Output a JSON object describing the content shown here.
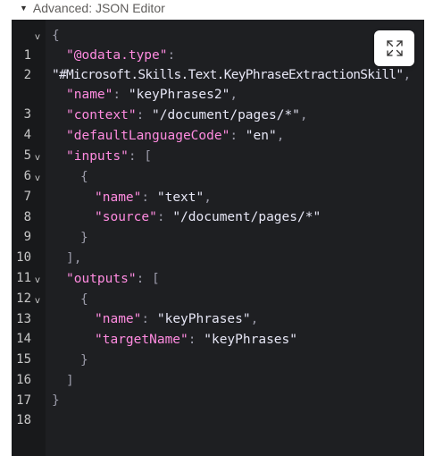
{
  "section": {
    "caret_icon": "caret-down-icon",
    "title": "Advanced: JSON Editor"
  },
  "editor": {
    "expand_icon": "expand-icon",
    "fold_glyph": "v",
    "lines": [
      {
        "n": "1",
        "text": "{"
      },
      {
        "n": "2",
        "key": "\"@odata.type\"",
        "sep": ":"
      },
      {
        "n": "",
        "value": "\"#Microsoft.Skills.Text.KeyPhraseExtractionSkill\"",
        "sep": ","
      },
      {
        "n": "3",
        "key": "\"name\"",
        "sep": ": ",
        "value": "\"keyPhrases2\"",
        "end": ","
      },
      {
        "n": "4",
        "key": "\"context\"",
        "sep": ": ",
        "value": "\"/document/pages/*\"",
        "end": ","
      },
      {
        "n": "5",
        "key": "\"defaultLanguageCode\"",
        "sep": ": ",
        "value": "\"en\"",
        "end": ","
      },
      {
        "n": "6",
        "key": "\"inputs\"",
        "sep": ": ["
      },
      {
        "n": "7",
        "text": "{"
      },
      {
        "n": "8",
        "key": "\"name\"",
        "sep": ": ",
        "value": "\"text\"",
        "end": ","
      },
      {
        "n": "9",
        "key": "\"source\"",
        "sep": ": ",
        "value": "\"/document/pages/*\""
      },
      {
        "n": "10",
        "text": "}"
      },
      {
        "n": "11",
        "text": "],"
      },
      {
        "n": "12",
        "key": "\"outputs\"",
        "sep": ": ["
      },
      {
        "n": "13",
        "text": "{"
      },
      {
        "n": "14",
        "key": "\"name\"",
        "sep": ": ",
        "value": "\"keyPhrases\"",
        "end": ","
      },
      {
        "n": "15",
        "key": "\"targetName\"",
        "sep": ": ",
        "value": "\"keyPhrases\""
      },
      {
        "n": "16",
        "text": "}"
      },
      {
        "n": "17",
        "text": "]"
      },
      {
        "n": "18",
        "text": "}"
      }
    ]
  }
}
